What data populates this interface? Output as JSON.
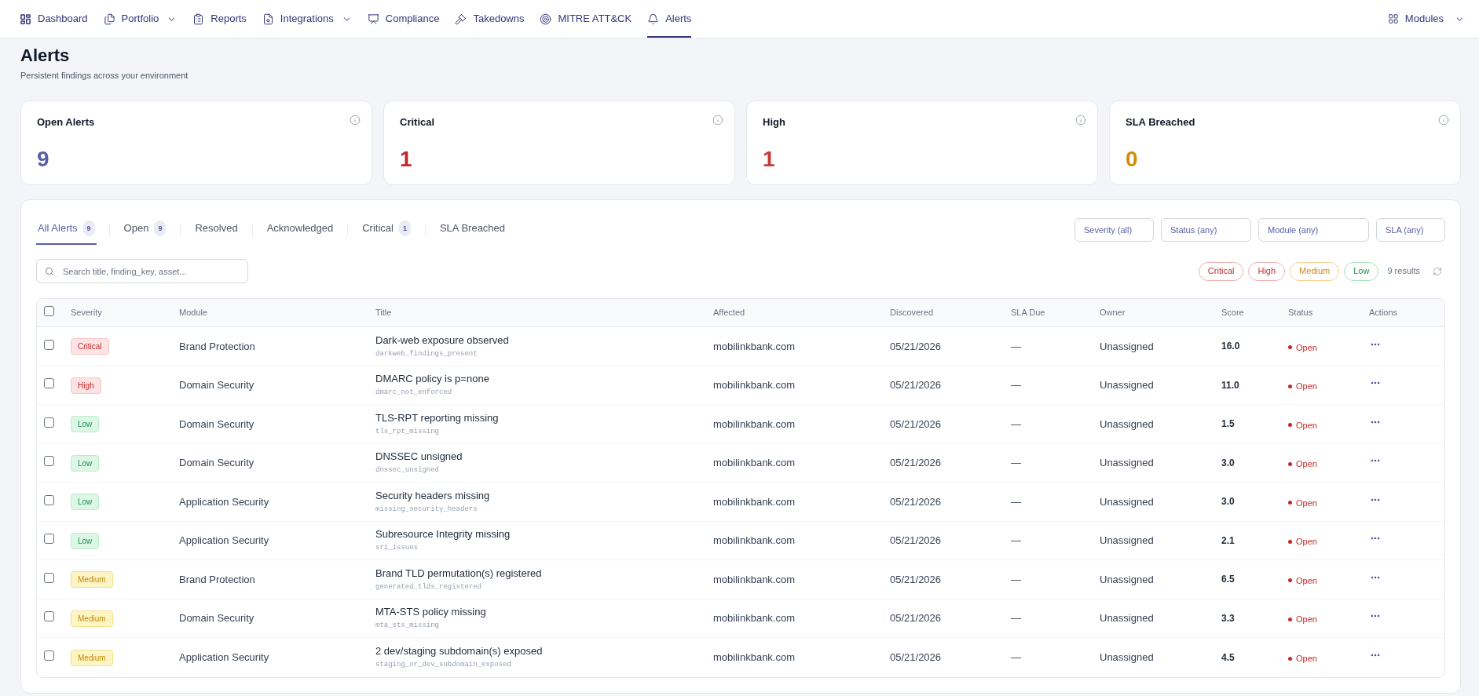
{
  "nav": {
    "items": [
      {
        "label": "Dashboard",
        "has_menu": false,
        "selected": false
      },
      {
        "label": "Portfolio",
        "has_menu": true,
        "selected": false
      },
      {
        "label": "Reports",
        "has_menu": false,
        "selected": false
      },
      {
        "label": "Integrations",
        "has_menu": true,
        "selected": false
      },
      {
        "label": "Compliance",
        "has_menu": false,
        "selected": false
      },
      {
        "label": "Takedowns",
        "has_menu": false,
        "selected": false
      },
      {
        "label": "MITRE ATT&CK",
        "has_menu": false,
        "selected": false
      },
      {
        "label": "Alerts",
        "has_menu": false,
        "selected": true
      }
    ],
    "modules_menu": {
      "label": "Modules",
      "has_menu": true
    }
  },
  "header": {
    "title": "Alerts",
    "subtitle": "Persistent findings across your environment"
  },
  "stat_cards": [
    {
      "label": "Open Alerts",
      "value": "9",
      "color": "#5a5ea8"
    },
    {
      "label": "Critical",
      "value": "1",
      "color": "#c1272d"
    },
    {
      "label": "High",
      "value": "1",
      "color": "#c53a3a"
    },
    {
      "label": "SLA Breached",
      "value": "0",
      "color": "#d18b0a"
    }
  ],
  "tabs": [
    {
      "label": "All Alerts",
      "count": "9",
      "selected": true
    },
    {
      "label": "Open",
      "count": "9",
      "selected": false
    },
    {
      "label": "Resolved",
      "selected": false
    },
    {
      "label": "Acknowledged",
      "selected": false
    },
    {
      "label": "Critical",
      "count": "1",
      "selected": false
    },
    {
      "label": "SLA Breached",
      "selected": false
    }
  ],
  "filters": [
    "Severity (all)",
    "Status (any)",
    "Module (any)",
    "SLA (any)"
  ],
  "search": {
    "placeholder": "Search title, finding_key, asset..."
  },
  "severity_chips": [
    {
      "label": "Critical",
      "kind": "critical"
    },
    {
      "label": "High",
      "kind": "high"
    },
    {
      "label": "Medium",
      "kind": "medium"
    },
    {
      "label": "Low",
      "kind": "low"
    }
  ],
  "results": "9 results",
  "table": {
    "select_all_checked": false,
    "columns": [
      "Severity",
      "Module",
      "Title",
      "Affected",
      "Discovered",
      "SLA Due",
      "Owner",
      "Score",
      "Status",
      "Actions"
    ],
    "rows": [
      {
        "checked": false,
        "severity": {
          "label": "Critical",
          "kind": "critical"
        },
        "module": "Brand Protection",
        "title": "Dark-web exposure observed",
        "finding_key": "darkweb_findings_present",
        "affected": "mobilinkbank.com",
        "discovered": "05/21/2026",
        "sla_due": "—",
        "owner": "Unassigned",
        "score": "16.0",
        "status": {
          "label": "Open",
          "kind": "open"
        }
      },
      {
        "checked": false,
        "severity": {
          "label": "High",
          "kind": "high"
        },
        "module": "Domain Security",
        "title": "DMARC policy is p=none",
        "finding_key": "dmarc_not_enforced",
        "affected": "mobilinkbank.com",
        "discovered": "05/21/2026",
        "sla_due": "—",
        "owner": "Unassigned",
        "score": "11.0",
        "status": {
          "label": "Open",
          "kind": "open"
        }
      },
      {
        "checked": false,
        "severity": {
          "label": "Low",
          "kind": "low"
        },
        "module": "Domain Security",
        "title": "TLS-RPT reporting missing",
        "finding_key": "tls_rpt_missing",
        "affected": "mobilinkbank.com",
        "discovered": "05/21/2026",
        "sla_due": "—",
        "owner": "Unassigned",
        "score": "1.5",
        "status": {
          "label": "Open",
          "kind": "open"
        }
      },
      {
        "checked": false,
        "severity": {
          "label": "Low",
          "kind": "low"
        },
        "module": "Domain Security",
        "title": "DNSSEC unsigned",
        "finding_key": "dnssec_unsigned",
        "affected": "mobilinkbank.com",
        "discovered": "05/21/2026",
        "sla_due": "—",
        "owner": "Unassigned",
        "score": "3.0",
        "status": {
          "label": "Open",
          "kind": "open"
        }
      },
      {
        "checked": false,
        "severity": {
          "label": "Low",
          "kind": "low"
        },
        "module": "Application Security",
        "title": "Security headers missing",
        "finding_key": "missing_security_headers",
        "affected": "mobilinkbank.com",
        "discovered": "05/21/2026",
        "sla_due": "—",
        "owner": "Unassigned",
        "score": "3.0",
        "status": {
          "label": "Open",
          "kind": "open"
        }
      },
      {
        "checked": false,
        "severity": {
          "label": "Low",
          "kind": "low"
        },
        "module": "Application Security",
        "title": "Subresource Integrity missing",
        "finding_key": "sri_issues",
        "affected": "mobilinkbank.com",
        "discovered": "05/21/2026",
        "sla_due": "—",
        "owner": "Unassigned",
        "score": "2.1",
        "status": {
          "label": "Open",
          "kind": "open"
        }
      },
      {
        "checked": false,
        "severity": {
          "label": "Medium",
          "kind": "medium"
        },
        "module": "Brand Protection",
        "title": "Brand TLD permutation(s) registered",
        "finding_key": "generated_tlds_registered",
        "affected": "mobilinkbank.com",
        "discovered": "05/21/2026",
        "sla_due": "—",
        "owner": "Unassigned",
        "score": "6.5",
        "status": {
          "label": "Open",
          "kind": "open"
        }
      },
      {
        "checked": false,
        "severity": {
          "label": "Medium",
          "kind": "medium"
        },
        "module": "Domain Security",
        "title": "MTA-STS policy missing",
        "finding_key": "mta_sts_missing",
        "affected": "mobilinkbank.com",
        "discovered": "05/21/2026",
        "sla_due": "—",
        "owner": "Unassigned",
        "score": "3.3",
        "status": {
          "label": "Open",
          "kind": "open"
        }
      },
      {
        "checked": false,
        "severity": {
          "label": "Medium",
          "kind": "medium"
        },
        "module": "Application Security",
        "title": "2 dev/staging subdomain(s) exposed",
        "finding_key": "staging_or_dev_subdomain_exposed",
        "affected": "mobilinkbank.com",
        "discovered": "05/21/2026",
        "sla_due": "—",
        "owner": "Unassigned",
        "score": "4.5",
        "status": {
          "label": "Open",
          "kind": "open"
        }
      }
    ]
  }
}
